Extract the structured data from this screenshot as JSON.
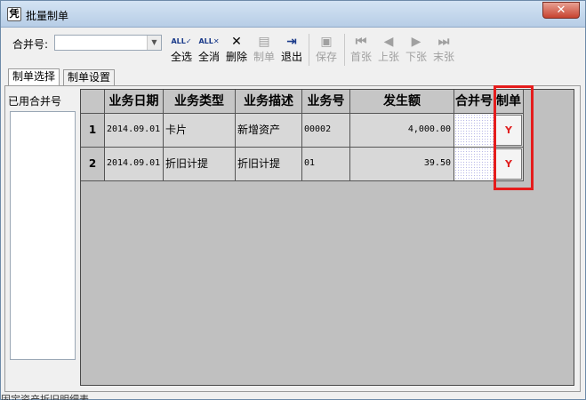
{
  "window": {
    "title": "批量制单",
    "close_glyph": "✕",
    "app_icon_glyph": "凭"
  },
  "toolbar": {
    "hebing_label": "合并号:",
    "hebing_value": "",
    "buttons": [
      {
        "label": "全选",
        "icon": "select-all-icon",
        "glyph": "ALL✓"
      },
      {
        "label": "全消",
        "icon": "deselect-all-icon",
        "glyph": "ALL✕"
      },
      {
        "label": "删除",
        "icon": "delete-icon",
        "glyph": "✕"
      },
      {
        "label": "制单",
        "icon": "voucher-icon",
        "glyph": "▤"
      },
      {
        "label": "退出",
        "icon": "exit-icon",
        "glyph": "⇥"
      },
      {
        "label": "保存",
        "icon": "save-icon",
        "glyph": "▣"
      },
      {
        "label": "首张",
        "icon": "first-icon",
        "glyph": "⏮"
      },
      {
        "label": "上张",
        "icon": "prev-icon",
        "glyph": "◀"
      },
      {
        "label": "下张",
        "icon": "next-icon",
        "glyph": "▶"
      },
      {
        "label": "末张",
        "icon": "last-icon",
        "glyph": "⏭"
      }
    ]
  },
  "tabs": [
    {
      "label": "制单选择"
    },
    {
      "label": "制单设置"
    }
  ],
  "sidebar": {
    "label": "已用合并号"
  },
  "grid": {
    "columns": [
      "业务日期",
      "业务类型",
      "业务描述",
      "业务号",
      "发生额",
      "合并号",
      "制单"
    ],
    "rows": [
      {
        "index": "1",
        "date": "2014.09.01",
        "type": "卡片",
        "desc": "新增资产",
        "no": "00002",
        "amount": "4,000.00",
        "merge": "",
        "flag": "Y"
      },
      {
        "index": "2",
        "date": "2014.09.01",
        "type": "折旧计提",
        "desc": "折旧计提",
        "no": "01",
        "amount": "39.50",
        "merge": "",
        "flag": "Y"
      }
    ]
  },
  "status": {
    "text": "固定资产折旧明细表"
  }
}
